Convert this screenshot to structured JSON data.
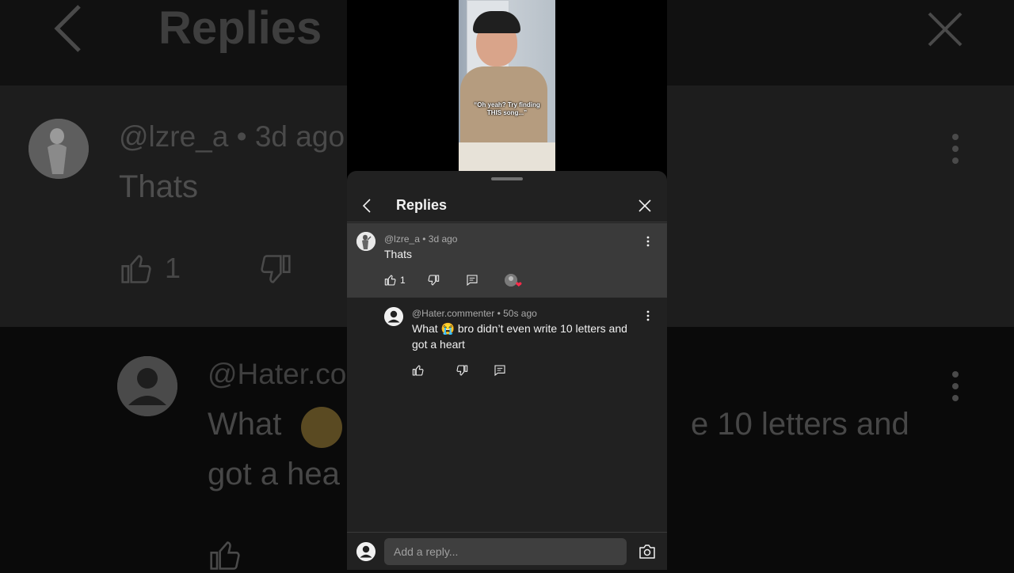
{
  "sheet": {
    "title": "Replies"
  },
  "video": {
    "caption": "“Oh yeah? Try finding THIS song...”"
  },
  "parent_comment": {
    "username": "@lzre_a",
    "time": "3d ago",
    "text": "Thats",
    "like_count": "1",
    "hearted": true
  },
  "reply_comment": {
    "username": "@Hater.commenter",
    "time": "50s ago",
    "text": "What 😭 bro didn’t even write 10 letters and got a heart"
  },
  "composer": {
    "placeholder": "Add a reply..."
  },
  "background": {
    "title": "Replies",
    "user1": "@lzre_a • 3d ago",
    "text1": "Thats",
    "like_count": "1",
    "user2": "@Hater.co",
    "text2_line1": "What",
    "text2_line1_end": "e 10 letters and",
    "text2_line2": "got a hea"
  },
  "separator": "•",
  "icons": [
    "chevron-left-icon",
    "close-icon",
    "more-vert-icon",
    "thumb-up-icon",
    "thumb-down-icon",
    "comment-reply-icon",
    "creator-heart-icon",
    "account-circle-icon",
    "camera-icon",
    "crying-emoji-icon"
  ],
  "colors": {
    "sheet_bg": "#212121",
    "highlight_bg": "#3a3a3a",
    "heart": "#ff2b4a",
    "meta_text": "#aaaaaa"
  }
}
